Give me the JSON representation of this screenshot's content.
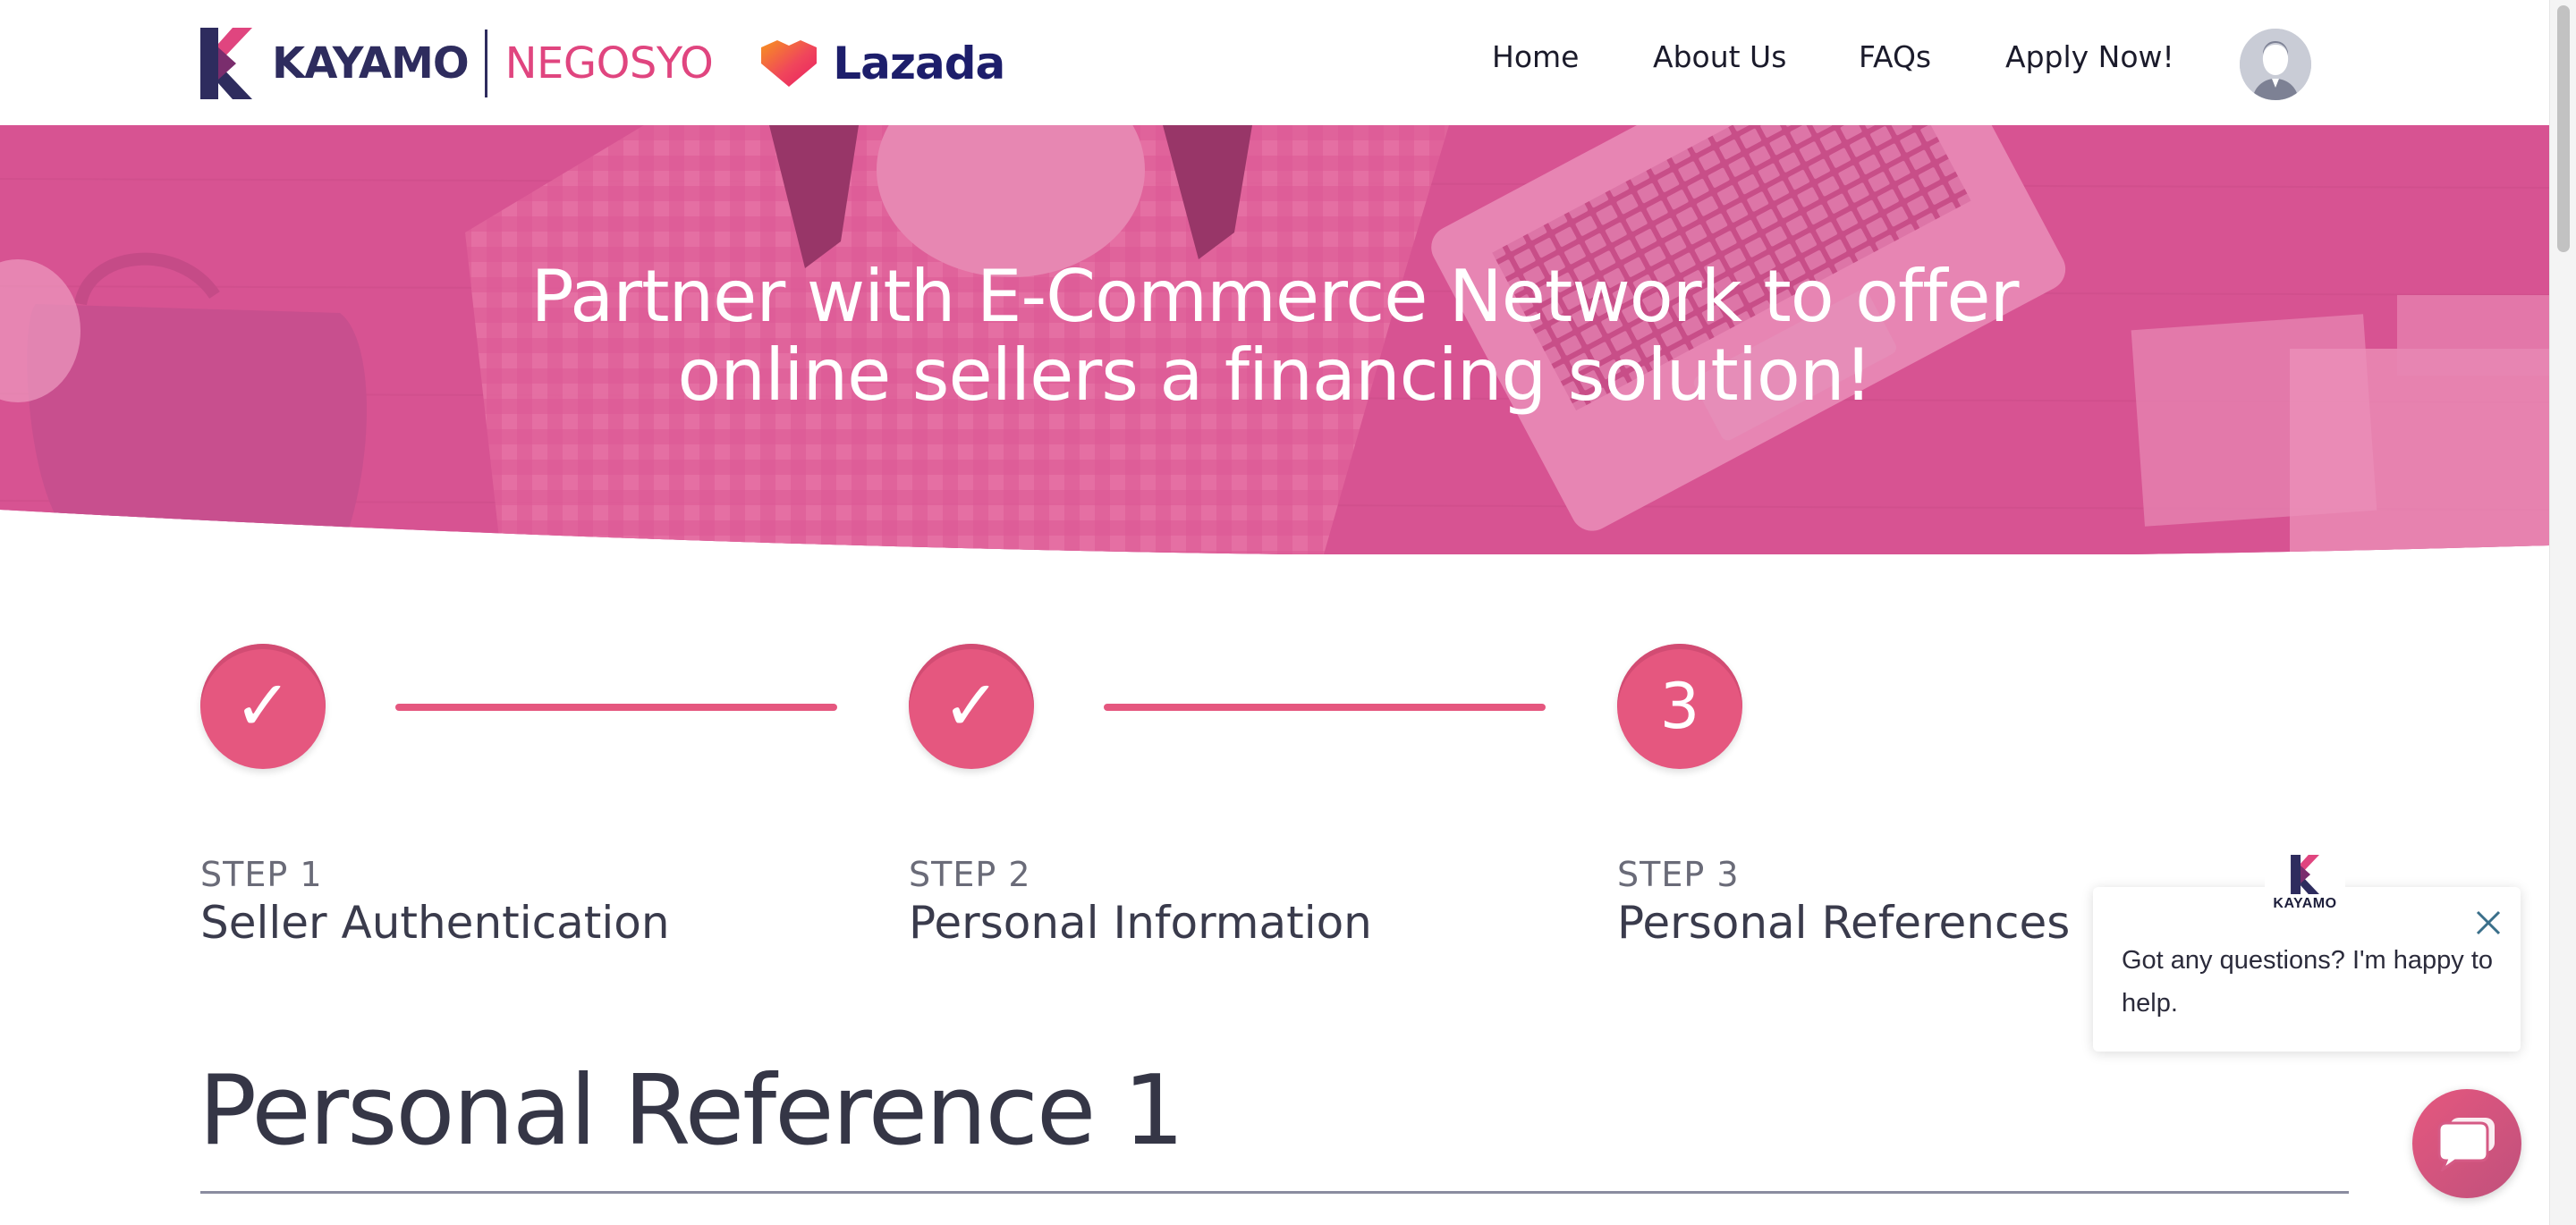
{
  "header": {
    "brand_kayamo": "KAYAMO",
    "brand_negosyo": "NEGOSYO",
    "brand_lazada": "Lazada",
    "nav": {
      "home": "Home",
      "about": "About Us",
      "faqs": "FAQs",
      "apply": "Apply Now!"
    },
    "avatar_icon": "user-avatar-icon"
  },
  "hero": {
    "title_line1": "Partner with E-Commerce Network to offer",
    "title_line2": "online sellers a financing solution!"
  },
  "steps": [
    {
      "kicker": "STEP 1",
      "title": "Seller Authentication",
      "status": "done",
      "icon": "check-icon"
    },
    {
      "kicker": "STEP 2",
      "title": "Personal Information",
      "status": "done",
      "icon": "check-icon"
    },
    {
      "kicker": "STEP 3",
      "title": "Personal References",
      "status": "current",
      "number": "3"
    }
  ],
  "section": {
    "title": "Personal Reference 1"
  },
  "chat": {
    "badge_text": "KAYAMO",
    "message": "Got any questions? I'm happy to help.",
    "close_icon": "close-icon",
    "fab_icon": "chat-bubble-icon"
  },
  "colors": {
    "accent": "#e5577f",
    "brand_navy": "#2e2c5e",
    "negosyo_pink": "#e0457f",
    "lazada_navy": "#1d1e6b",
    "text_dark": "#3a3b4c"
  }
}
